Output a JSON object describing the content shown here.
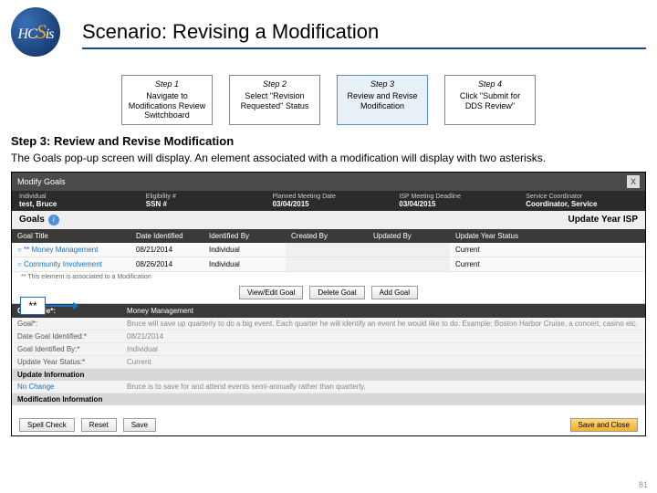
{
  "logo": {
    "h": "H",
    "c": "C",
    "s": "S",
    "is": "is"
  },
  "title": "Scenario: Revising a Modification",
  "steps": [
    {
      "num": "Step 1",
      "text": "Navigate to Modifications Review Switchboard"
    },
    {
      "num": "Step 2",
      "text": "Select \"Revision Requested\" Status"
    },
    {
      "num": "Step 3",
      "text": "Review and Revise Modification"
    },
    {
      "num": "Step 4",
      "text": "Click \"Submit for DDS Review\""
    }
  ],
  "section_title": "Step 3: Review and Revise Modification",
  "intro": "The Goals pop-up screen will display. An element associated with a modification will display with two asterisks.",
  "callout": "**",
  "modal": {
    "title": "Modify Goals",
    "topbar": {
      "indiv_label": "Individual",
      "indiv_val": "test, Bruce",
      "elig_label": "Eligibility #",
      "elig_val": "SSN #",
      "planned_label": "Planned Meeting Date",
      "planned_val": "03/04/2015",
      "deadline_label": "ISP Meeting Deadline",
      "deadline_val": "03/04/2015",
      "coord_label": "Service Coordinator",
      "coord_val": "Coordinator, Service"
    },
    "goals_title": "Goals",
    "update_year": "Update Year ISP",
    "cols": {
      "c1": "Goal Title",
      "c2": "Date Identified",
      "c3": "Identified By",
      "c4": "Created By",
      "c5": "Updated By",
      "c6": "Update Year Status"
    },
    "rows": [
      {
        "title": "** Money Management",
        "date": "08/21/2014",
        "idby": "Individual",
        "status": "Current"
      },
      {
        "title": "Community Involvement",
        "date": "08/26/2014",
        "idby": "Individual",
        "status": "Current"
      }
    ],
    "assoc_note": "** This element is associated to a Modification",
    "btn_view": "View/Edit Goal",
    "btn_delete": "Delete Goal",
    "btn_add": "Add Goal",
    "detail": {
      "head_label": "Goal Title*:",
      "head_val": "Money Management",
      "rows": [
        {
          "lbl": "Goal*:",
          "v": "Bruce will save up quarterly to do a big event. Each quarter he will identify an event he would like to do. Example: Boston Harbor Cruise, a concert, casino etc."
        },
        {
          "lbl": "Date Goal Identified:*",
          "v": "08/21/2014"
        },
        {
          "lbl": "Goal Identified By:*",
          "v": "Individual"
        },
        {
          "lbl": "Update Year Status:*",
          "v": "Current"
        }
      ],
      "sub1": "Update Information",
      "nochange": "No Change",
      "sub2": "Modification Information",
      "mod_text": "Bruce is to save for and attend events semi-annually rather than quarterly."
    },
    "btn_spell": "Spell Check",
    "btn_reset": "Reset",
    "btn_save": "Save",
    "btn_saveclose": "Save and Close"
  },
  "pagenum": "81"
}
